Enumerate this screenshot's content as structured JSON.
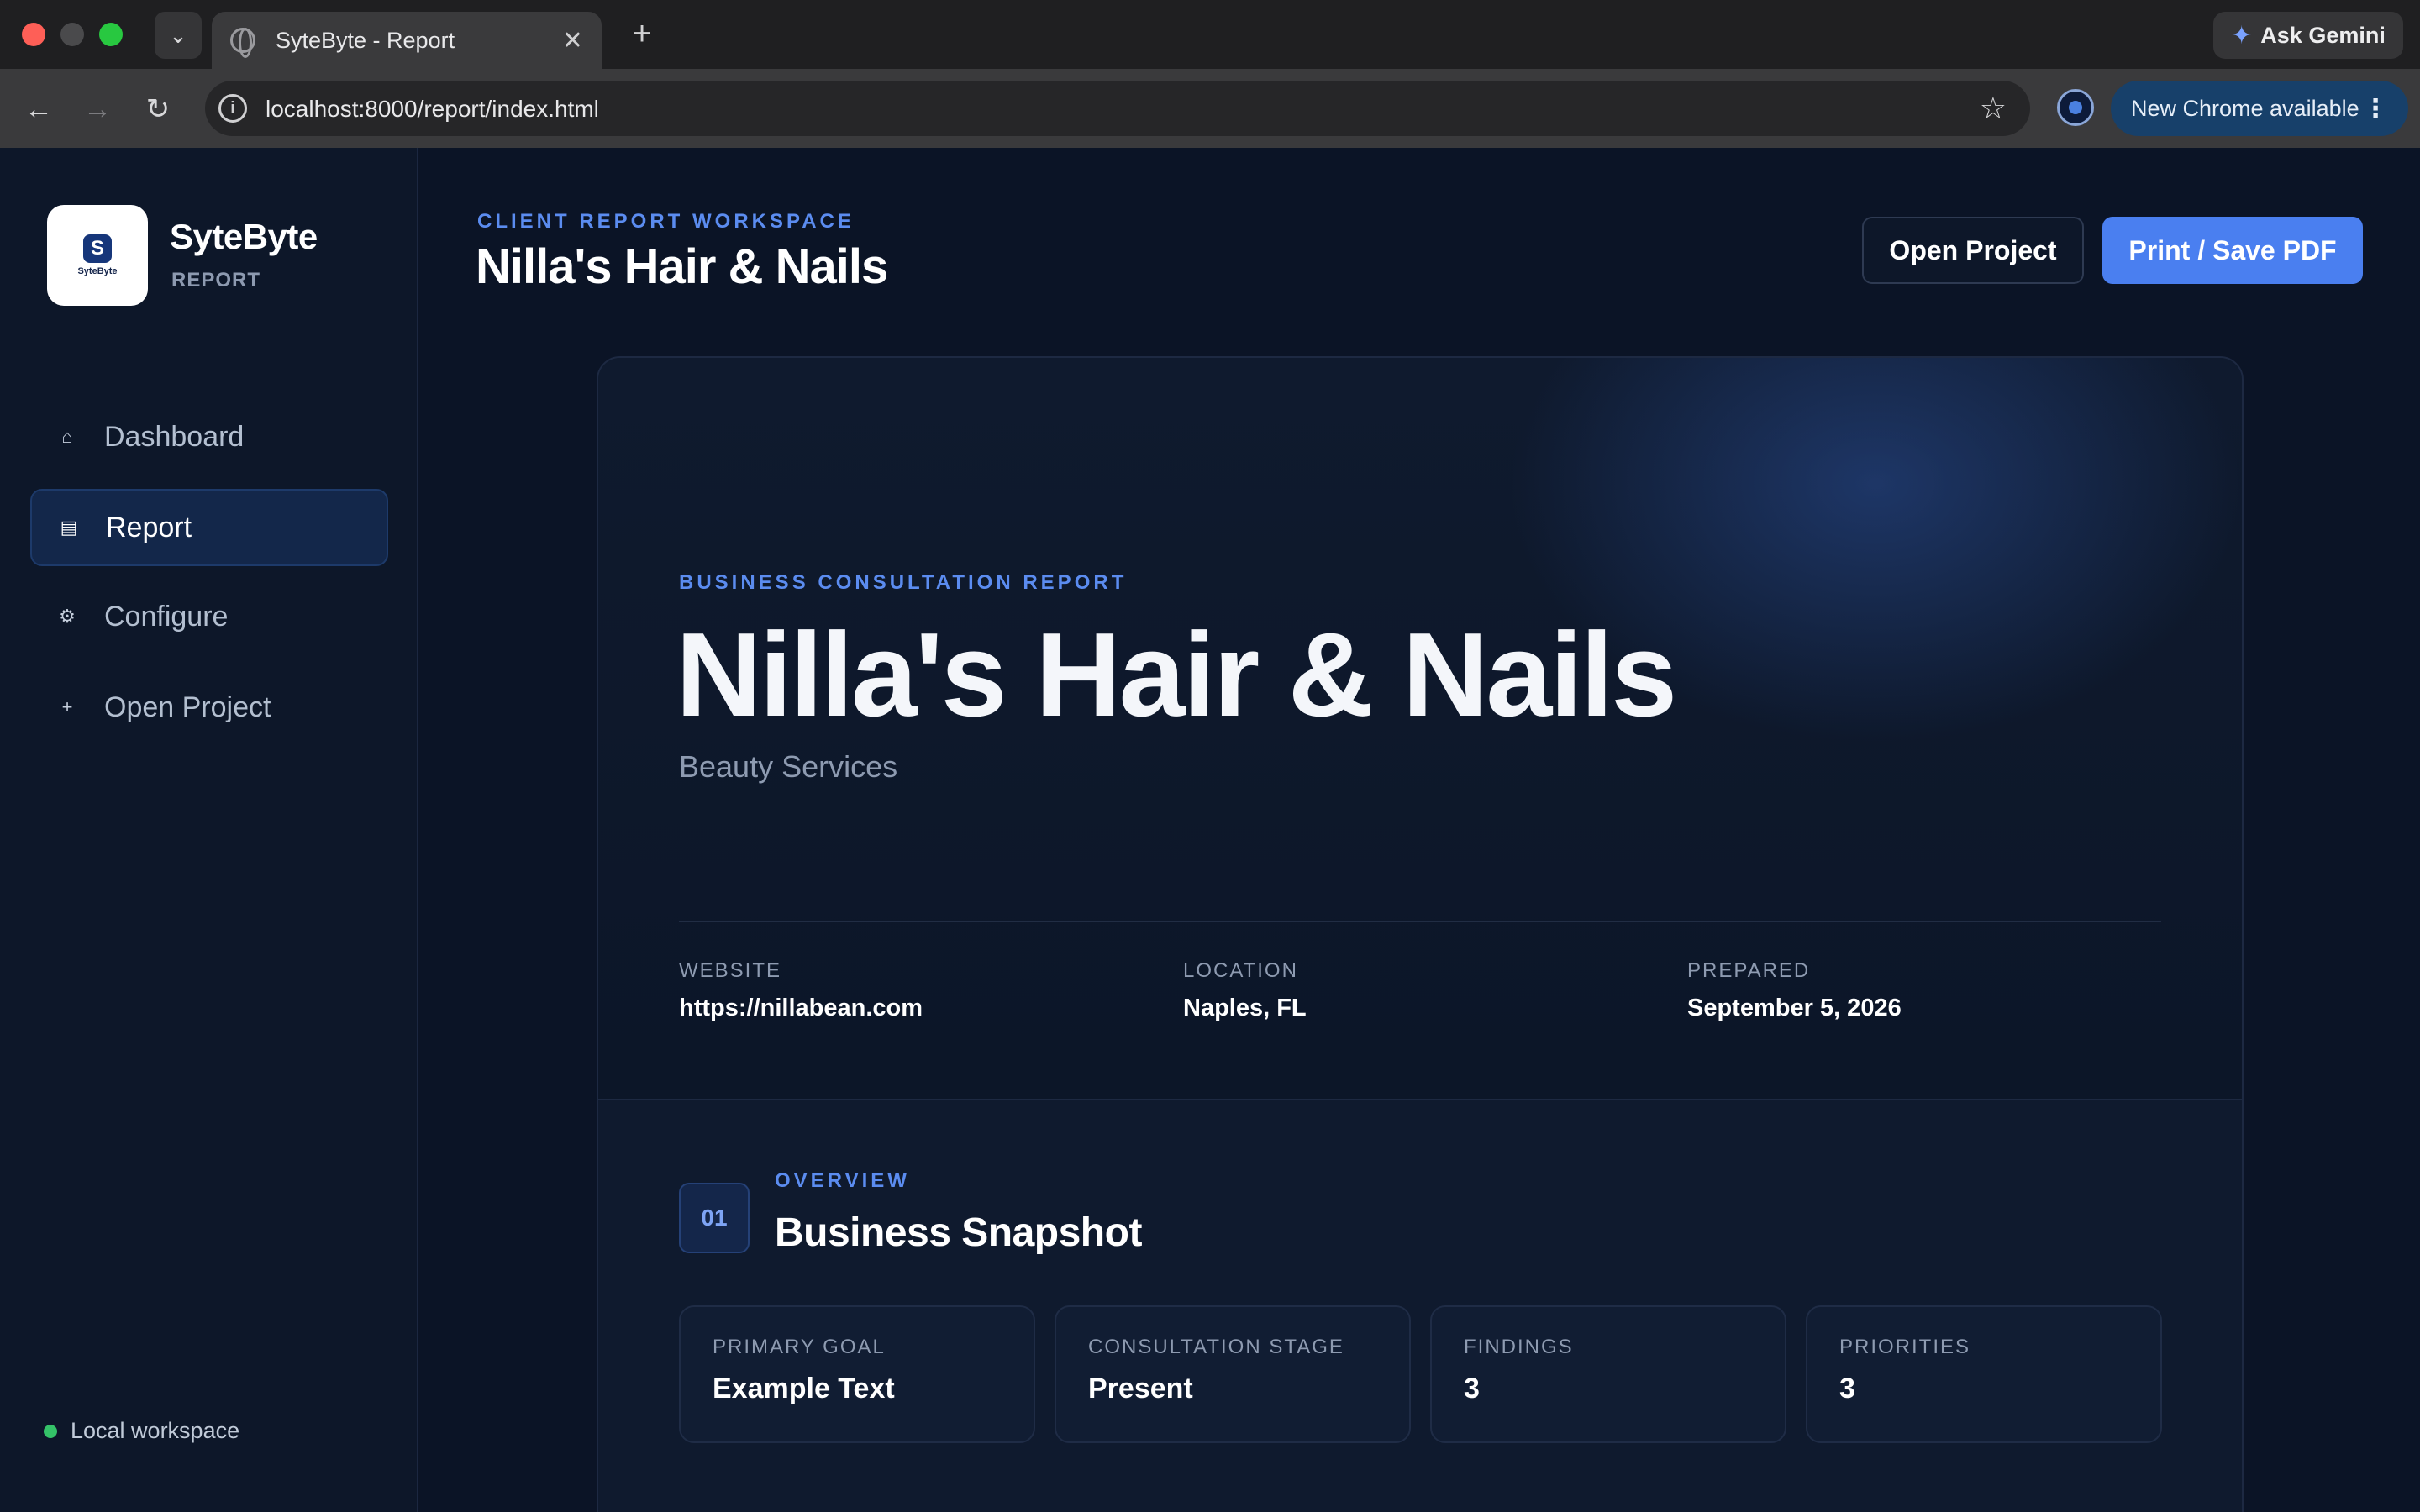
{
  "browser": {
    "tab_title": "SyteByte - Report",
    "url": "localhost:8000/report/index.html",
    "gemini_label": "Ask Gemini",
    "update_label": "New Chrome available"
  },
  "sidebar": {
    "brand_name": "SyteByte",
    "brand_sub": "REPORT",
    "logo_text": "SyteByte",
    "nav": [
      {
        "label": "Dashboard",
        "icon": "home-icon",
        "active": false
      },
      {
        "label": "Report",
        "icon": "document-icon",
        "active": true
      },
      {
        "label": "Configure",
        "icon": "gear-icon",
        "active": false
      },
      {
        "label": "Open Project",
        "icon": "plus-icon",
        "active": false
      }
    ],
    "status": "Local workspace",
    "status_color": "#34c268"
  },
  "header": {
    "eyebrow": "CLIENT REPORT WORKSPACE",
    "title": "Nilla's Hair & Nails",
    "open_project": "Open Project",
    "print": "Print / Save PDF"
  },
  "report": {
    "eyebrow": "BUSINESS CONSULTATION REPORT",
    "business_name": "Nilla's Hair & Nails",
    "category": "Beauty Services",
    "meta": [
      {
        "label": "WEBSITE",
        "value": "https://nillabean.com"
      },
      {
        "label": "LOCATION",
        "value": "Naples, FL"
      },
      {
        "label": "PREPARED",
        "value": "September 5, 2026"
      }
    ],
    "section": {
      "number": "01",
      "eyebrow": "OVERVIEW",
      "title": "Business Snapshot"
    },
    "stats": [
      {
        "label": "PRIMARY GOAL",
        "value": "Example Text"
      },
      {
        "label": "CONSULTATION STAGE",
        "value": "Present"
      },
      {
        "label": "FINDINGS",
        "value": "3"
      },
      {
        "label": "PRIORITIES",
        "value": "3"
      }
    ]
  },
  "colors": {
    "accent": "#4a7ff0",
    "eyebrow": "#5b8cf0",
    "background": "#0b1426"
  }
}
